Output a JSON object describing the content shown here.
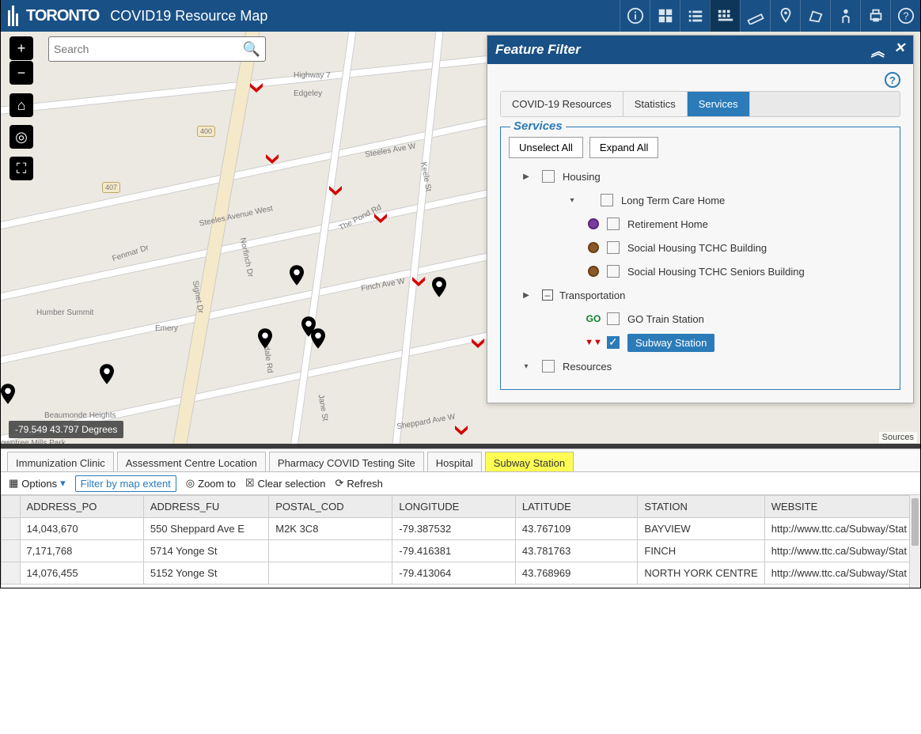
{
  "header": {
    "logo": "Toronto",
    "title": "COVID19 Resource Map",
    "tools": [
      "info",
      "grid-4",
      "list",
      "grid-active",
      "ruler",
      "pin",
      "polygon",
      "person",
      "print",
      "help"
    ]
  },
  "search": {
    "placeholder": "Search"
  },
  "map": {
    "coords": "-79.549 43.797 Degrees",
    "credits": "Sources",
    "streets": [
      "Highway 7",
      "Edgeley",
      "Steeles Ave W",
      "Steeles Avenue West",
      "Finch Ave W",
      "The Pond Rd",
      "Sheppard Ave W",
      "Keele St",
      "Oakdale Rd",
      "Signet Dr",
      "Norfinch Dr",
      "Humber Summit",
      "Beaumonde Heights",
      "Fenmar Dr",
      "Emery",
      "Jane St",
      "owntree Mills Park",
      "400",
      "407"
    ]
  },
  "panel": {
    "title": "Feature Filter",
    "tabs": [
      "COVID-19 Resources",
      "Statistics",
      "Services"
    ],
    "active_tab": 2,
    "fieldset_title": "Services",
    "btn_unselect": "Unselect All",
    "btn_expand": "Expand All",
    "tree": {
      "housing": {
        "label": "Housing",
        "children": [
          {
            "label": "Long Term Care Home",
            "icon": null
          },
          {
            "label": "Retirement Home",
            "icon": "purple"
          },
          {
            "label": "Social Housing TCHC Building",
            "icon": "brown"
          },
          {
            "label": "Social Housing TCHC Seniors Building",
            "icon": "brown"
          }
        ]
      },
      "transportation": {
        "label": "Transportation",
        "children": [
          {
            "label": "GO Train Station",
            "icon": "go"
          },
          {
            "label": "Subway Station",
            "icon": "ttc",
            "selected": true
          }
        ]
      },
      "resources": {
        "label": "Resources"
      }
    }
  },
  "attr": {
    "tabs": [
      "Immunization Clinic",
      "Assessment Centre Location",
      "Pharmacy COVID Testing Site",
      "Hospital",
      "Subway Station"
    ],
    "active_tab": 4,
    "toolbar": {
      "options": "Options",
      "filter": "Filter by map extent",
      "zoom": "Zoom to",
      "clear": "Clear selection",
      "refresh": "Refresh"
    },
    "columns": [
      "ADDRESS_PO",
      "ADDRESS_FU",
      "POSTAL_COD",
      "LONGITUDE",
      "LATITUDE",
      "STATION",
      "WEBSITE"
    ],
    "rows": [
      [
        "14,043,670",
        "550 Sheppard Ave E",
        "M2K 3C8",
        "-79.387532",
        "43.767109",
        "BAYVIEW",
        "http://www.ttc.ca/Subway/Stat"
      ],
      [
        "7,171,768",
        "5714 Yonge St",
        "",
        "-79.416381",
        "43.781763",
        "FINCH",
        "http://www.ttc.ca/Subway/Stat"
      ],
      [
        "14,076,455",
        "5152 Yonge St",
        "",
        "-79.413064",
        "43.768969",
        "NORTH YORK CENTRE",
        "http://www.ttc.ca/Subway/Stat"
      ]
    ]
  }
}
